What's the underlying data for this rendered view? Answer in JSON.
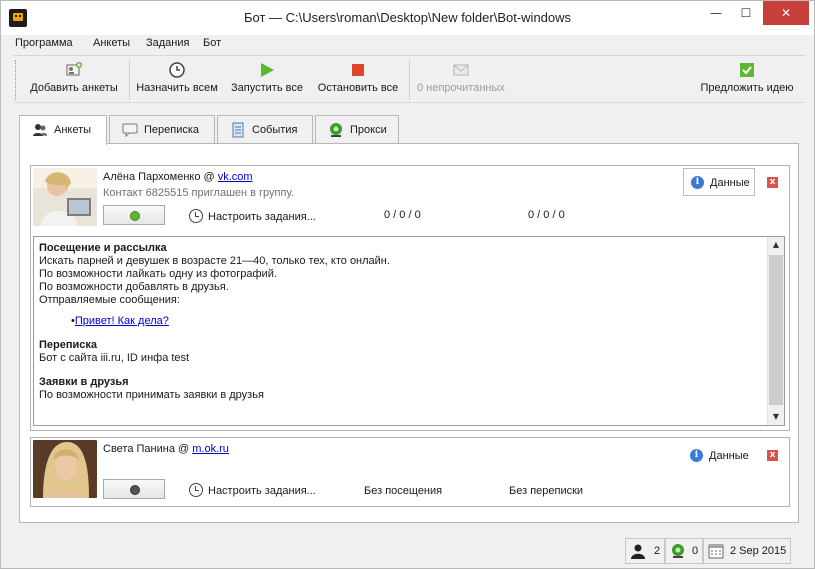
{
  "window": {
    "title": "Бот — C:\\Users\\roman\\Desktop\\New folder\\Bot-windows",
    "controls": {
      "minimize": "—",
      "maximize": "☐",
      "close": "✕"
    }
  },
  "menu": [
    "Программа",
    "Анкеты",
    "Задания",
    "Бот"
  ],
  "toolbar": {
    "add_profiles": "Добавить анкеты",
    "assign_all": "Назначить всем",
    "start_all": "Запустить все",
    "stop_all": "Остановить все",
    "unread": "0 непрочитанных",
    "suggest_idea": "Предложить идею"
  },
  "tabs": [
    "Анкеты",
    "Переписка",
    "События",
    "Прокси"
  ],
  "profiles": [
    {
      "name": "Алёна Пархоменко @ ",
      "network": "vk.com",
      "status": "Контакт 6825515 приглашен в группу.",
      "toggle_state": "on",
      "configure": "Настроить задания...",
      "stat1": "0 / 0 / 0",
      "stat2": "0 / 0 / 0",
      "data_label": "Данные",
      "delete": "x",
      "details": {
        "visits_title": "Посещение и рассылка",
        "visits_lines": [
          "Искать парней и девушек в возрасте 21—40, только тех, кто онлайн.",
          "По возможности лайкать одну из фотографий.",
          "По возможности добавлять в друзья.",
          "Отправляемые сообщения:"
        ],
        "message_bullet": "•",
        "message": "Привет! Как дела?",
        "chat_title": "Переписка",
        "chat_text": "Бот с сайта iii.ru, ID инфа test",
        "friends_title": "Заявки в друзья",
        "friends_text": "По возможности принимать заявки в друзья"
      }
    },
    {
      "name": "Света Панина @ ",
      "network": "m.ok.ru",
      "toggle_state": "off",
      "configure": "Настроить задания...",
      "stat1": "Без посещения",
      "stat2": "Без переписки",
      "data_label": "Данные",
      "delete": "x"
    }
  ],
  "statusbar": {
    "users": "2",
    "online": "0",
    "date": "2 Sep 2015"
  },
  "colors": {
    "accent_green": "#5cb82e",
    "led_off": "#555555",
    "close_red": "#c7413a",
    "link_blue": "#0000cc"
  },
  "icons": [
    "app-icon",
    "add-profile-icon",
    "clock-icon",
    "play-icon",
    "stop-icon",
    "mail-icon",
    "idea-icon",
    "users-icon",
    "chat-icon",
    "events-icon",
    "proxy-icon",
    "info-icon",
    "calendar-icon"
  ]
}
